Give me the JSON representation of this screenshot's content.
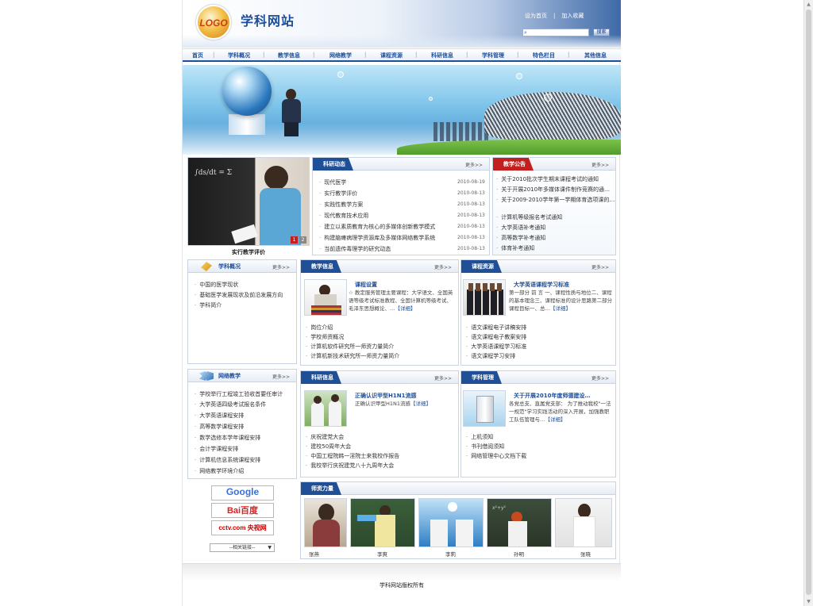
{
  "header": {
    "logo_text": "LOGO",
    "site_title": "学科网站",
    "set_home": "设为首页",
    "separator": "|",
    "add_fav": "加入收藏",
    "search_placeholder": "",
    "search_button": "搜索"
  },
  "nav": [
    "首页",
    "学科概况",
    "教学信息",
    "网络教学",
    "课程资源",
    "科研信息",
    "学科管理",
    "特色栏目",
    "其他信息"
  ],
  "feature": {
    "caption": "实行教学评价",
    "pages": [
      "1",
      "2"
    ]
  },
  "more_label": "更多>>",
  "research_news": {
    "title": "科研动态",
    "items": [
      {
        "text": "现代医学",
        "date": "2010-08-19"
      },
      {
        "text": "实行教学评价",
        "date": "2010-08-13"
      },
      {
        "text": "实践性教学方案",
        "date": "2010-08-13"
      },
      {
        "text": "现代教育技术应用",
        "date": "2010-08-13"
      },
      {
        "text": "建立以素质教育为核心的多媒体创新教学模式",
        "date": "2010-08-13"
      },
      {
        "text": "构建脑瘫病理学资源库及多媒体网络教学系统",
        "date": "2010-08-13"
      },
      {
        "text": "当前遗传毒理学的研究动态",
        "date": "2010-08-13"
      }
    ]
  },
  "notice": {
    "title": "教学公告",
    "items": [
      "关于2010批次学生期末课程考试的通知",
      "关于开展2010年多媒体课件制作竞赛的通…",
      "关于2009-2010学年第一学期体育选项课的…",
      "计算机等级报名考试通知",
      "大学英语补考通知",
      "高等数学补考通知",
      "体育补考通知"
    ]
  },
  "overview": {
    "title": "学科概况",
    "items": [
      "中国的医学现状",
      "基础医学发展现状及前沿发展方向",
      "学科简介"
    ]
  },
  "teaching_info": {
    "title": "教学信息",
    "headline": "课程设置",
    "body": "☆ 教定服务管理主要课程：大学语文、全国英语等级考试标准教程、全国计算机等级考试、毛泽东思想概论、…",
    "detail": "【详细】",
    "items": [
      "岗位介绍",
      "学校师资概况",
      "计算机软件研究所一师资力量简介",
      "计算机新技术研究所一师资力量简介"
    ]
  },
  "course_resources": {
    "title": "课程资源",
    "headline": "大学英语课程学习标准",
    "body": "第一部分 前 言 一、课程性质与地位二、课程的基本理念三、课程标准的设计思路第二部分 课程目标一、总…",
    "detail": "【详细】",
    "items": [
      "语文课程电子讲稿安排",
      "语文课程电子教案安排",
      "大学英语课程学习标准",
      "语文课程学习安排"
    ]
  },
  "online_teaching": {
    "title": "网络教学",
    "items": [
      "学校举行工程竣工验收首要任审计",
      "大学英语四级考试报名条件",
      "大学英语课程安排",
      "高等数学课程安排",
      "数学选修本学年课程安排",
      "会计学课程安排",
      "计算机信息系统课程安排",
      "网络教学环境介绍"
    ]
  },
  "research_info": {
    "title": "科研信息",
    "headline": "正确认识甲型H1N1流感",
    "body": "正确认识甲型H1N1流感",
    "detail": "【详细】",
    "items": [
      "庆祝建党大会",
      "建校50周年大会",
      "中国工程院韩一淫院士来我校作报告",
      "我校举行庆祝建党八十九周年大会"
    ]
  },
  "discipline_mgmt": {
    "title": "学科管理",
    "headline": "关于开展2010年度师德建设…",
    "body": "各党总支、直属党支部： 为了推动我校\"一法一规范\"学习实践活动的深入开展，加强教职工队伍管理与…",
    "detail": "【详细】",
    "items": [
      "上机须知",
      "书刊借阅须知",
      "网络管理中心文档下载"
    ]
  },
  "faculty": {
    "title": "师资力量",
    "names": [
      "张燕",
      "李爽",
      "李莉",
      "孙明",
      "张晓"
    ]
  },
  "links": {
    "google": "Google",
    "baidu": "Bai百度",
    "cctv": "cctv.com 央视网",
    "select": "--相关链接--"
  },
  "footer": "学科网站版权所有",
  "colors": {
    "primary": "#1f4f97",
    "accent_red": "#c41f1f",
    "link": "#1d4e9a"
  }
}
